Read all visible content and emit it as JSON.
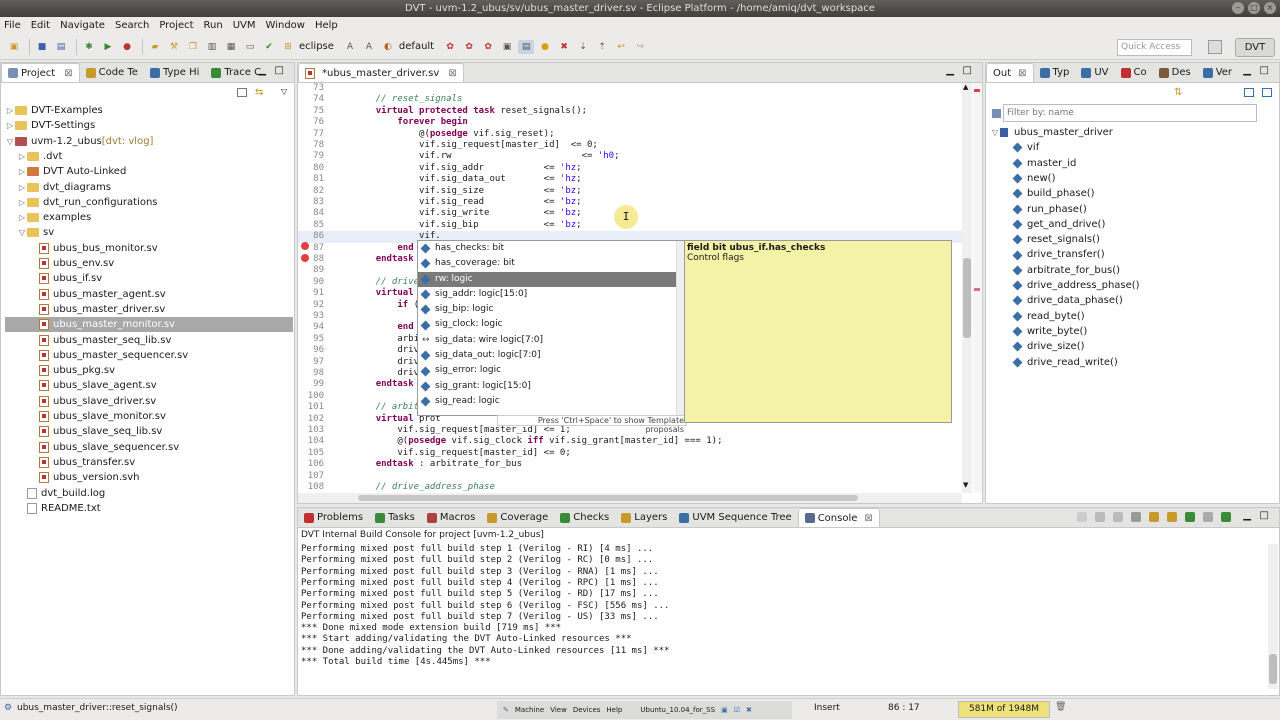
{
  "window": {
    "title": "DVT - uvm-1.2_ubus/sv/ubus_master_driver.sv - Eclipse Platform - /home/amiq/dvt_workspace"
  },
  "menu": [
    "File",
    "Edit",
    "Navigate",
    "Search",
    "Project",
    "Run",
    "UVM",
    "Window",
    "Help"
  ],
  "toolbar": {
    "eclipse_label": "eclipse",
    "default_label": "default",
    "quick_access": "Quick Access",
    "perspective": "DVT"
  },
  "project_panel": {
    "tabs": [
      "Project",
      "Code Te",
      "Type Hi",
      "Trace C"
    ],
    "items": [
      {
        "label": "DVT-Examples"
      },
      {
        "label": "DVT-Settings"
      },
      {
        "label": "uvm-1.2_ubus",
        "suffix": " [dvt: vlog]"
      },
      {
        "label": ".dvt"
      },
      {
        "label": "DVT Auto-Linked"
      },
      {
        "label": "dvt_diagrams"
      },
      {
        "label": "dvt_run_configurations"
      },
      {
        "label": "examples"
      },
      {
        "label": "sv"
      },
      {
        "label": "ubus_bus_monitor.sv"
      },
      {
        "label": "ubus_env.sv"
      },
      {
        "label": "ubus_if.sv"
      },
      {
        "label": "ubus_master_agent.sv"
      },
      {
        "label": "ubus_master_driver.sv"
      },
      {
        "label": "ubus_master_monitor.sv"
      },
      {
        "label": "ubus_master_seq_lib.sv"
      },
      {
        "label": "ubus_master_sequencer.sv"
      },
      {
        "label": "ubus_pkg.sv"
      },
      {
        "label": "ubus_slave_agent.sv"
      },
      {
        "label": "ubus_slave_driver.sv"
      },
      {
        "label": "ubus_slave_monitor.sv"
      },
      {
        "label": "ubus_slave_seq_lib.sv"
      },
      {
        "label": "ubus_slave_sequencer.sv"
      },
      {
        "label": "ubus_transfer.sv"
      },
      {
        "label": "ubus_version.svh"
      },
      {
        "label": "dvt_build.log"
      },
      {
        "label": "README.txt"
      }
    ]
  },
  "editor": {
    "tab": "*ubus_master_driver.sv",
    "lines": [
      {
        "n": "73",
        "t": ""
      },
      {
        "n": "74",
        "t": "    // reset_signals"
      },
      {
        "n": "75",
        "t": "    virtual protected task reset_signals();"
      },
      {
        "n": "76",
        "t": "        forever begin"
      },
      {
        "n": "77",
        "t": "            @(posedge vif.sig_reset);"
      },
      {
        "n": "78",
        "t": "            vif.sig_request[master_id]  <= 0;"
      },
      {
        "n": "79",
        "t": "            vif.rw                        <= 'h0;"
      },
      {
        "n": "80",
        "t": "            vif.sig_addr           <= 'hz;"
      },
      {
        "n": "81",
        "t": "            vif.sig_data_out       <= 'hz;"
      },
      {
        "n": "82",
        "t": "            vif.sig_size           <= 'bz;"
      },
      {
        "n": "83",
        "t": "            vif.sig_read           <= 'bz;"
      },
      {
        "n": "84",
        "t": "            vif.sig_write          <= 'bz;"
      },
      {
        "n": "85",
        "t": "            vif.sig_bip            <= 'bz;"
      },
      {
        "n": "86",
        "t": "            vif."
      },
      {
        "n": "87",
        "t": "        end"
      },
      {
        "n": "88",
        "t": "    endtask : re"
      },
      {
        "n": "89",
        "t": ""
      },
      {
        "n": "90",
        "t": "    // drive_tra"
      },
      {
        "n": "91",
        "t": "    virtual prote"
      },
      {
        "n": "92",
        "t": "        if (tran"
      },
      {
        "n": "93",
        "t": "            repe"
      },
      {
        "n": "94",
        "t": "        end"
      },
      {
        "n": "95",
        "t": "        arbitrat"
      },
      {
        "n": "96",
        "t": "        drive_ad"
      },
      {
        "n": "97",
        "t": "        drive_da"
      },
      {
        "n": "98",
        "t": "        drive_re"
      },
      {
        "n": "99",
        "t": "    endtask : dr"
      },
      {
        "n": "100",
        "t": ""
      },
      {
        "n": "101",
        "t": "    // arbitrate"
      },
      {
        "n": "102",
        "t": "    virtual prot"
      },
      {
        "n": "103",
        "t": "        vif.sig_request[master_id] <= 1;"
      },
      {
        "n": "104",
        "t": "        @(posedge vif.sig_clock iff vif.sig_grant[master_id] === 1);"
      },
      {
        "n": "105",
        "t": "        vif.sig_request[master_id] <= 0;"
      },
      {
        "n": "106",
        "t": "    endtask : arbitrate_for_bus"
      },
      {
        "n": "107",
        "t": ""
      },
      {
        "n": "108",
        "t": "    // drive_address_phase"
      }
    ]
  },
  "completion": {
    "items": [
      "has_checks: bit",
      "has_coverage: bit",
      "rw: logic",
      "sig_addr: logic[15:0]",
      "sig_bip: logic",
      "sig_clock: logic",
      "sig_data: wire logic[7:0]",
      "sig_data_out: logic[7:0]",
      "sig_error: logic",
      "sig_grant: logic[15:0]",
      "sig_read: logic"
    ],
    "hint": "Press 'Ctrl+Space' to show Template proposals",
    "info_title": "field bit ubus_if.has_checks",
    "info_body": "Control flags"
  },
  "outline": {
    "tabs": [
      "Out",
      "Typ",
      "UV",
      "Co",
      "Des",
      "Ver"
    ],
    "filter_placeholder": "Filter by: name",
    "root": "ubus_master_driver",
    "items": [
      "vif",
      "master_id",
      "new()",
      "build_phase()",
      "run_phase()",
      "get_and_drive()",
      "reset_signals()",
      "drive_transfer()",
      "arbitrate_for_bus()",
      "drive_address_phase()",
      "drive_data_phase()",
      "read_byte()",
      "write_byte()",
      "drive_size()",
      "drive_read_write()"
    ]
  },
  "console": {
    "tabs": [
      "Problems",
      "Tasks",
      "Macros",
      "Coverage",
      "Checks",
      "Layers",
      "UVM Sequence Tree",
      "Console"
    ],
    "header": "DVT Internal Build Console for project [uvm-1.2_ubus]",
    "lines": [
      "Performing mixed post full build step 1 (Verilog - RI) [4 ms] ...",
      "Performing mixed post full build step 2 (Verilog - RC) [0 ms] ...",
      "Performing mixed post full build step 3 (Verilog - RNA) [1 ms] ...",
      "Performing mixed post full build step 4 (Verilog - RPC) [1 ms] ...",
      "Performing mixed post full build step 5 (Verilog - RD) [17 ms] ...",
      "Performing mixed post full build step 6 (Verilog - FSC) [556 ms] ...",
      "Performing mixed post full build step 7 (Verilog - US) [33 ms] ...",
      "*** Done mixed mode extension build [719 ms] ***",
      "*** Start adding/validating the DVT Auto-Linked resources ***",
      "*** Done adding/validating the DVT Auto-Linked resources [11 ms] ***",
      "*** Total build time [4s.445ms] ***"
    ]
  },
  "status": {
    "context": "ubus_master_driver::reset_signals()",
    "taskbar": [
      "Machine",
      "View",
      "Devices",
      "Help",
      "Ubuntu_10.04_for_SS"
    ],
    "mode": "Insert",
    "position": "86 : 17",
    "memory": "581M of 1948M"
  }
}
